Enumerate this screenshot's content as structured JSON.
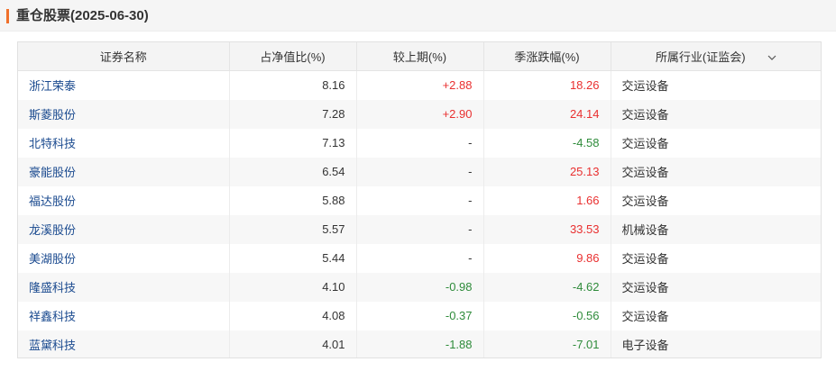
{
  "section": {
    "title": "重仓股票(2025-06-30)"
  },
  "table": {
    "headers": {
      "name": "证券名称",
      "net_ratio": "占净值比(%)",
      "vs_prev": "较上期(%)",
      "quarter_change": "季涨跌幅(%)",
      "industry": "所属行业(证监会)"
    },
    "industry_dropdown_icon": "chevron-down-icon",
    "rows": [
      {
        "name": "浙江荣泰",
        "net_ratio": "8.16",
        "vs_prev": "+2.88",
        "quarter_change": "18.26",
        "industry": "交运设备"
      },
      {
        "name": "斯菱股份",
        "net_ratio": "7.28",
        "vs_prev": "+2.90",
        "quarter_change": "24.14",
        "industry": "交运设备"
      },
      {
        "name": "北特科技",
        "net_ratio": "7.13",
        "vs_prev": "-",
        "quarter_change": "-4.58",
        "industry": "交运设备"
      },
      {
        "name": "豪能股份",
        "net_ratio": "6.54",
        "vs_prev": "-",
        "quarter_change": "25.13",
        "industry": "交运设备"
      },
      {
        "name": "福达股份",
        "net_ratio": "5.88",
        "vs_prev": "-",
        "quarter_change": "1.66",
        "industry": "交运设备"
      },
      {
        "name": "龙溪股份",
        "net_ratio": "5.57",
        "vs_prev": "-",
        "quarter_change": "33.53",
        "industry": "机械设备"
      },
      {
        "name": "美湖股份",
        "net_ratio": "5.44",
        "vs_prev": "-",
        "quarter_change": "9.86",
        "industry": "交运设备"
      },
      {
        "name": "隆盛科技",
        "net_ratio": "4.10",
        "vs_prev": "-0.98",
        "quarter_change": "-4.62",
        "industry": "交运设备"
      },
      {
        "name": "祥鑫科技",
        "net_ratio": "4.08",
        "vs_prev": "-0.37",
        "quarter_change": "-0.56",
        "industry": "交运设备"
      },
      {
        "name": "蓝黛科技",
        "net_ratio": "4.01",
        "vs_prev": "-1.88",
        "quarter_change": "-7.01",
        "industry": "电子设备"
      }
    ]
  },
  "colors": {
    "accent": "#f0702b",
    "link": "#1a4a8f",
    "up": "#e93030",
    "down": "#2e8b3a"
  }
}
